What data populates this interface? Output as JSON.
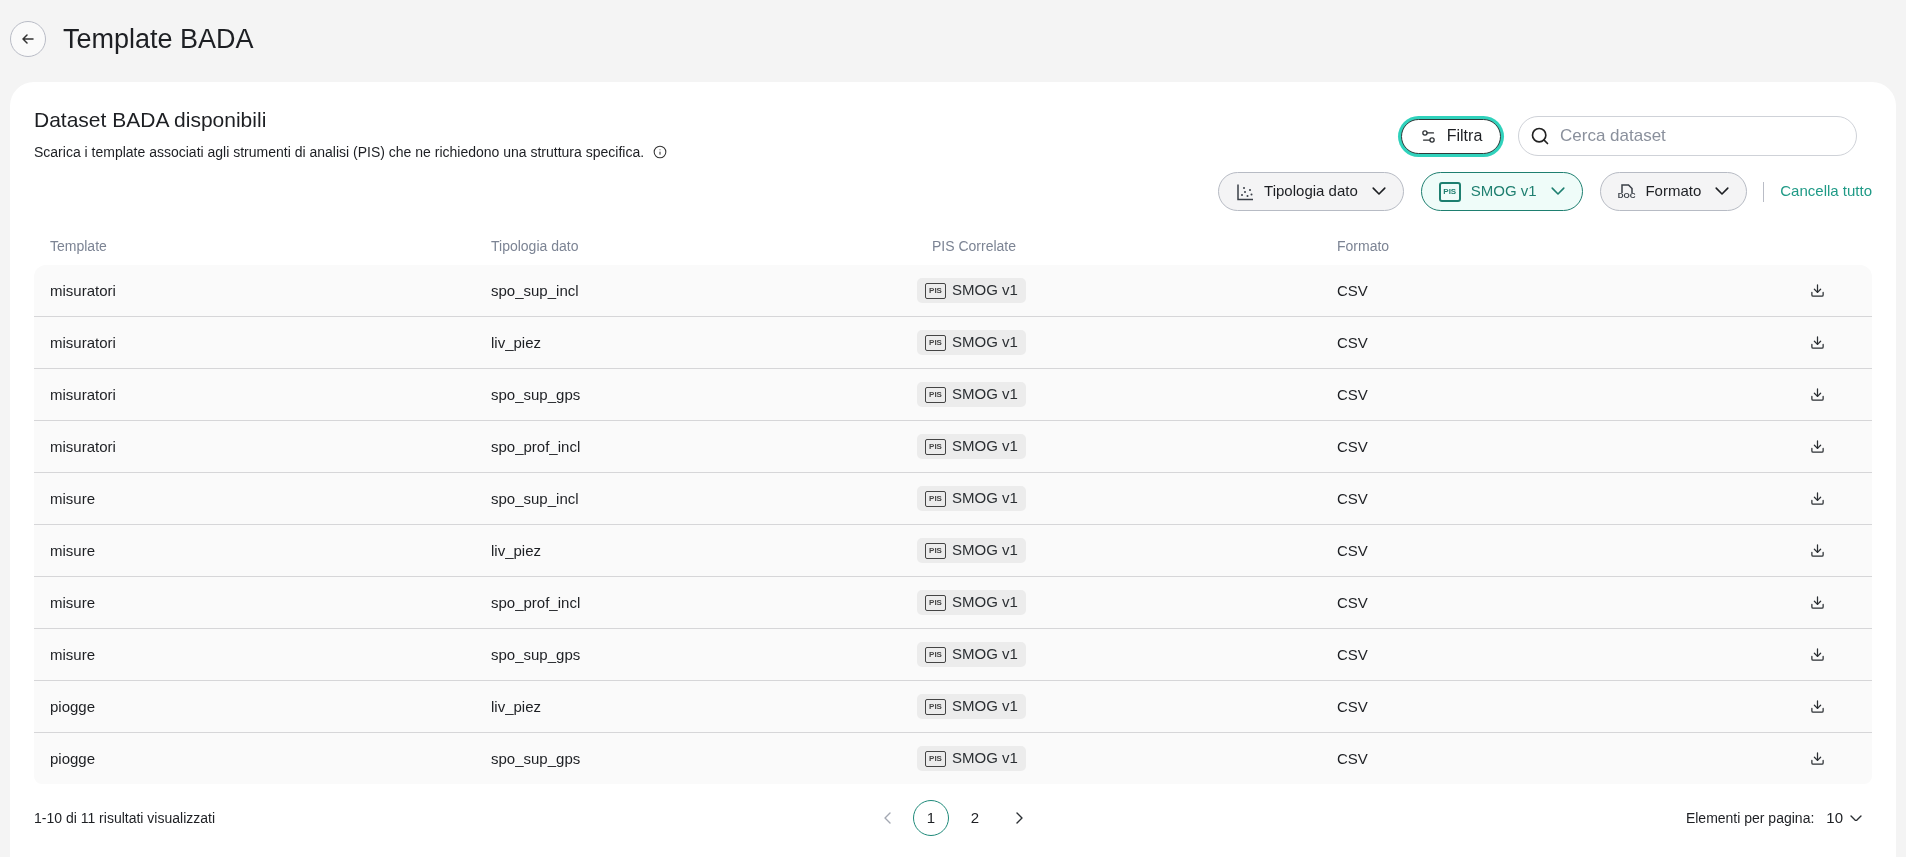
{
  "header": {
    "title": "Template BADA"
  },
  "card": {
    "title": "Dataset BADA disponibili",
    "description": "Scarica i template associati agli strumenti di analisi (PIS) che ne richiedono una struttura specifica."
  },
  "toolbar": {
    "filter_button": {
      "label": "Filtra",
      "selected": true
    },
    "search": {
      "placeholder": "Cerca dataset"
    }
  },
  "filters": [
    {
      "kind": "scatter",
      "label": "Tipologia dato",
      "selected": false
    },
    {
      "kind": "pis",
      "tag": "PIS",
      "label": "SMOG v1",
      "selected": true
    },
    {
      "kind": "doc",
      "tag": "DOC",
      "label": "Formato",
      "selected": false
    }
  ],
  "clear_all": "Cancella tutto",
  "table": {
    "columns": [
      "Template",
      "Tipologia dato",
      "PIS Correlate",
      "Formato"
    ],
    "rows": [
      {
        "template": "misuratori",
        "type": "spo_sup_incl",
        "pis": {
          "tag": "PIS",
          "label": "SMOG v1"
        },
        "format": "CSV"
      },
      {
        "template": "misuratori",
        "type": "liv_piez",
        "pis": {
          "tag": "PIS",
          "label": "SMOG v1"
        },
        "format": "CSV"
      },
      {
        "template": "misuratori",
        "type": "spo_sup_gps",
        "pis": {
          "tag": "PIS",
          "label": "SMOG v1"
        },
        "format": "CSV"
      },
      {
        "template": "misuratori",
        "type": "spo_prof_incl",
        "pis": {
          "tag": "PIS",
          "label": "SMOG v1"
        },
        "format": "CSV"
      },
      {
        "template": "misure",
        "type": "spo_sup_incl",
        "pis": {
          "tag": "PIS",
          "label": "SMOG v1"
        },
        "format": "CSV"
      },
      {
        "template": "misure",
        "type": "liv_piez",
        "pis": {
          "tag": "PIS",
          "label": "SMOG v1"
        },
        "format": "CSV"
      },
      {
        "template": "misure",
        "type": "spo_prof_incl",
        "pis": {
          "tag": "PIS",
          "label": "SMOG v1"
        },
        "format": "CSV"
      },
      {
        "template": "misure",
        "type": "spo_sup_gps",
        "pis": {
          "tag": "PIS",
          "label": "SMOG v1"
        },
        "format": "CSV"
      },
      {
        "template": "piogge",
        "type": "liv_piez",
        "pis": {
          "tag": "PIS",
          "label": "SMOG v1"
        },
        "format": "CSV"
      },
      {
        "template": "piogge",
        "type": "spo_sup_gps",
        "pis": {
          "tag": "PIS",
          "label": "SMOG v1"
        },
        "format": "CSV"
      }
    ]
  },
  "footer": {
    "summary": "1-10 di 11 risultati visualizzati",
    "pagination": {
      "prev": {
        "disabled": true
      },
      "pages": [
        {
          "label": "1",
          "selected": true
        },
        {
          "label": "2",
          "selected": false
        }
      ],
      "next": {
        "disabled": false
      }
    },
    "page_size": {
      "label": "Elementi per pagina:",
      "value": "10"
    }
  }
}
